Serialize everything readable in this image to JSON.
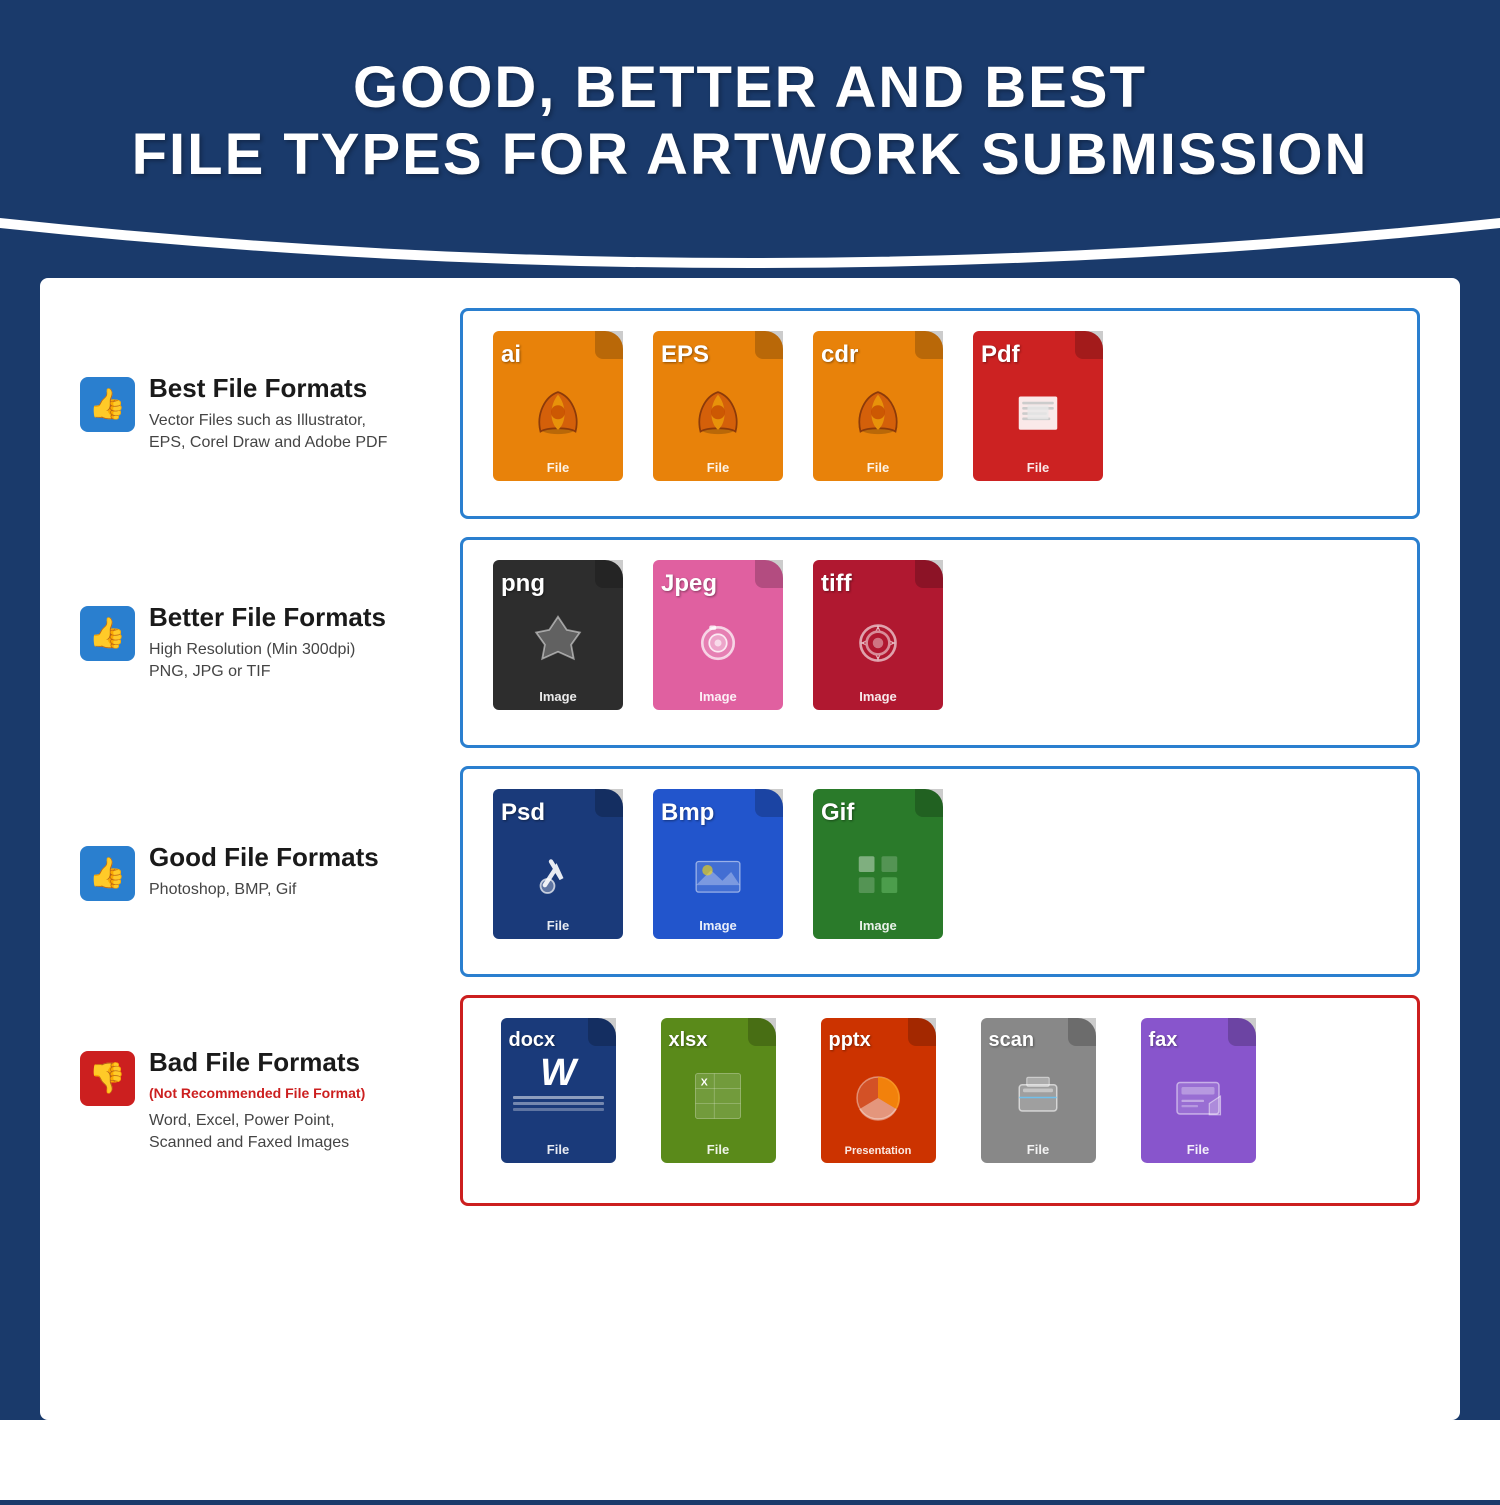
{
  "header": {
    "title_line1": "GOOD, BETTER AND BEST",
    "title_line2": "FILE TYPES FOR ARTWORK SUBMISSION"
  },
  "rows": [
    {
      "id": "best",
      "thumb": "👍",
      "thumb_type": "up",
      "label": "Best File Formats",
      "description": "Vector Files such as Illustrator,\nEPS, Corel Draw and Adobe PDF",
      "border_color": "blue",
      "files": [
        {
          "ext": "ai",
          "color": "orange",
          "label": "File",
          "graphic": "pen"
        },
        {
          "ext": "EPS",
          "color": "orange",
          "label": "File",
          "graphic": "pen"
        },
        {
          "ext": "cdr",
          "color": "orange",
          "label": "File",
          "graphic": "pen"
        },
        {
          "ext": "Pdf",
          "color": "red",
          "label": "File",
          "graphic": "doc"
        }
      ]
    },
    {
      "id": "better",
      "thumb": "👍",
      "thumb_type": "up",
      "label": "Better File Formats",
      "description": "High Resolution (Min 300dpi)\nPNG, JPG or TIF",
      "border_color": "blue",
      "files": [
        {
          "ext": "png",
          "color": "black",
          "label": "Image",
          "graphic": "star"
        },
        {
          "ext": "Jpeg",
          "color": "pink",
          "label": "Image",
          "graphic": "camera"
        },
        {
          "ext": "tiff",
          "color": "crimson",
          "label": "Image",
          "graphic": "flower"
        }
      ]
    },
    {
      "id": "good",
      "thumb": "👍",
      "thumb_type": "up",
      "label": "Good File Formats",
      "description": "Photoshop, BMP, Gif",
      "border_color": "blue",
      "files": [
        {
          "ext": "Psd",
          "color": "navy",
          "label": "File",
          "graphic": "brush"
        },
        {
          "ext": "Bmp",
          "color": "royal-blue",
          "label": "Image",
          "graphic": "landscape"
        },
        {
          "ext": "Gif",
          "color": "forest-green",
          "label": "Image",
          "graphic": "grid"
        }
      ]
    },
    {
      "id": "bad",
      "thumb": "👎",
      "thumb_type": "down",
      "label": "Bad File Formats",
      "label_sub": "(Not Recommended File Format)",
      "description": "Word, Excel, Power Point,\nScanned and Faxed Images",
      "border_color": "red",
      "files": [
        {
          "ext": "docx",
          "color": "navy",
          "label": "File",
          "graphic": "w"
        },
        {
          "ext": "xlsx",
          "color": "olive-green",
          "label": "File",
          "graphic": "x"
        },
        {
          "ext": "pptx",
          "color": "red-orange",
          "label": "Presentation",
          "graphic": "pie"
        },
        {
          "ext": "scan",
          "color": "gray",
          "label": "File",
          "graphic": "scanner"
        },
        {
          "ext": "fax",
          "color": "purple",
          "label": "File",
          "graphic": "fax"
        }
      ]
    }
  ]
}
